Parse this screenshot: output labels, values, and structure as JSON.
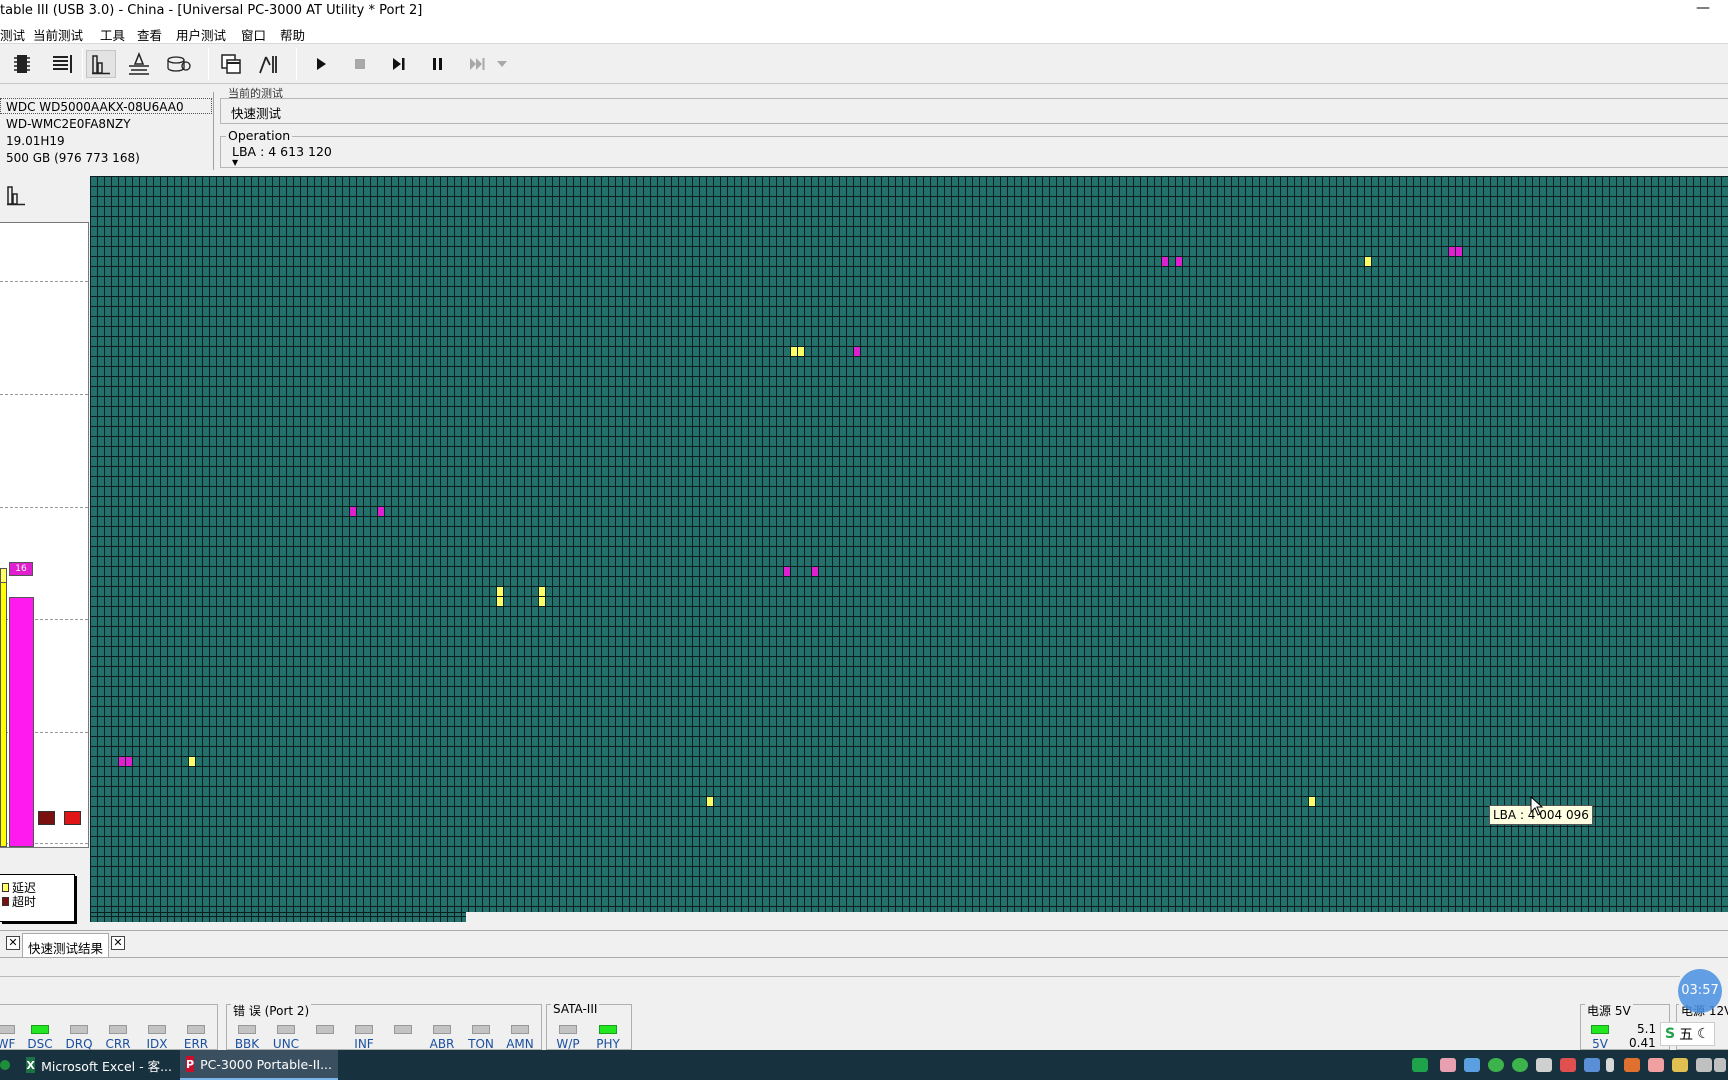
{
  "window": {
    "title": "table III (USB 3.0) - China - [Universal PC-3000 AT Utility * Port 2]",
    "minimize_symbol": "—"
  },
  "menu": [
    "测试",
    "当前测试",
    "工具",
    "查看",
    "用户测试",
    "窗口",
    "帮助"
  ],
  "toolbar": {
    "icons": [
      "chip-icon",
      "list-icon",
      "histogram-icon",
      "test-tool-icon",
      "drive-icon",
      "copy-window-icon",
      "run-script-icon",
      "play-icon",
      "stop-icon",
      "step-forward-icon",
      "pause-icon",
      "skip-icon",
      "dropdown-icon"
    ]
  },
  "drive": {
    "model": "WDC WD5000AAKX-08U6AA0",
    "serial": "WD-WMC2E0FA8NZY",
    "firmware": "19.01H19",
    "capacity": "500 GB (976 773 168)"
  },
  "current_test": {
    "legend": "当前的测试",
    "name": "快速测试"
  },
  "operation": {
    "legend": "Operation",
    "value": "LBA : 4 613 120"
  },
  "histogram": {
    "bar_label": "16",
    "legend": {
      "delay": "延迟",
      "timeout": "超时"
    }
  },
  "sector_map": {
    "tooltip": "LBA : 4 004 096",
    "colors": {
      "good": "#24706c",
      "grid": "#0b1d1c",
      "delay": "#ffff66",
      "error": "#e020d0"
    },
    "marks": [
      {
        "col": 153,
        "row": 8,
        "kind": "err"
      },
      {
        "col": 155,
        "row": 8,
        "kind": "err"
      },
      {
        "col": 182,
        "row": 8,
        "kind": "delay"
      },
      {
        "col": 194,
        "row": 7,
        "kind": "err"
      },
      {
        "col": 195,
        "row": 7,
        "kind": "err"
      },
      {
        "col": 100,
        "row": 17,
        "kind": "delay"
      },
      {
        "col": 101,
        "row": 17,
        "kind": "delay"
      },
      {
        "col": 109,
        "row": 17,
        "kind": "err"
      },
      {
        "col": 37,
        "row": 33,
        "kind": "err"
      },
      {
        "col": 41,
        "row": 33,
        "kind": "err"
      },
      {
        "col": 99,
        "row": 39,
        "kind": "err"
      },
      {
        "col": 103,
        "row": 39,
        "kind": "err"
      },
      {
        "col": 58,
        "row": 41,
        "kind": "delay"
      },
      {
        "col": 58,
        "row": 42,
        "kind": "delay"
      },
      {
        "col": 64,
        "row": 41,
        "kind": "delay"
      },
      {
        "col": 64,
        "row": 42,
        "kind": "delay"
      },
      {
        "col": 4,
        "row": 58,
        "kind": "err"
      },
      {
        "col": 5,
        "row": 58,
        "kind": "err"
      },
      {
        "col": 14,
        "row": 58,
        "kind": "delay"
      },
      {
        "col": 88,
        "row": 62,
        "kind": "delay"
      },
      {
        "col": 174,
        "row": 62,
        "kind": "delay"
      }
    ]
  },
  "results_tab": {
    "label": "快速测试结果",
    "close": "✕"
  },
  "status": {
    "left_group": [
      {
        "label": "WF",
        "on": false
      },
      {
        "label": "DSC",
        "on": true
      },
      {
        "label": "DRQ",
        "on": false
      },
      {
        "label": "CRR",
        "on": false
      },
      {
        "label": "IDX",
        "on": false
      },
      {
        "label": "ERR",
        "on": false
      }
    ],
    "error_group_title": "错 误 (Port 2)",
    "error_group": [
      {
        "label": "BBK",
        "on": false
      },
      {
        "label": "UNC",
        "on": false
      },
      {
        "label": "",
        "on": false
      },
      {
        "label": "INF",
        "on": false
      },
      {
        "label": "",
        "on": false
      },
      {
        "label": "ABR",
        "on": false
      },
      {
        "label": "TON",
        "on": false
      },
      {
        "label": "AMN",
        "on": false
      }
    ],
    "sata_group_title": "SATA-III",
    "sata_group": [
      {
        "label": "W/P",
        "on": false
      },
      {
        "label": "PHY",
        "on": true
      }
    ],
    "power": {
      "title": "电源 5V",
      "label": "5V",
      "voltage": "5.1",
      "current": "0.41",
      "next_title": "电源 12V"
    },
    "clock": "03:57",
    "ime": "五"
  },
  "taskbar": {
    "items": [
      {
        "label": "Microsoft Excel - 客...",
        "icon": "X",
        "active": false
      },
      {
        "label": "PC-3000 Portable-II...",
        "icon": "P",
        "active": true
      }
    ]
  }
}
